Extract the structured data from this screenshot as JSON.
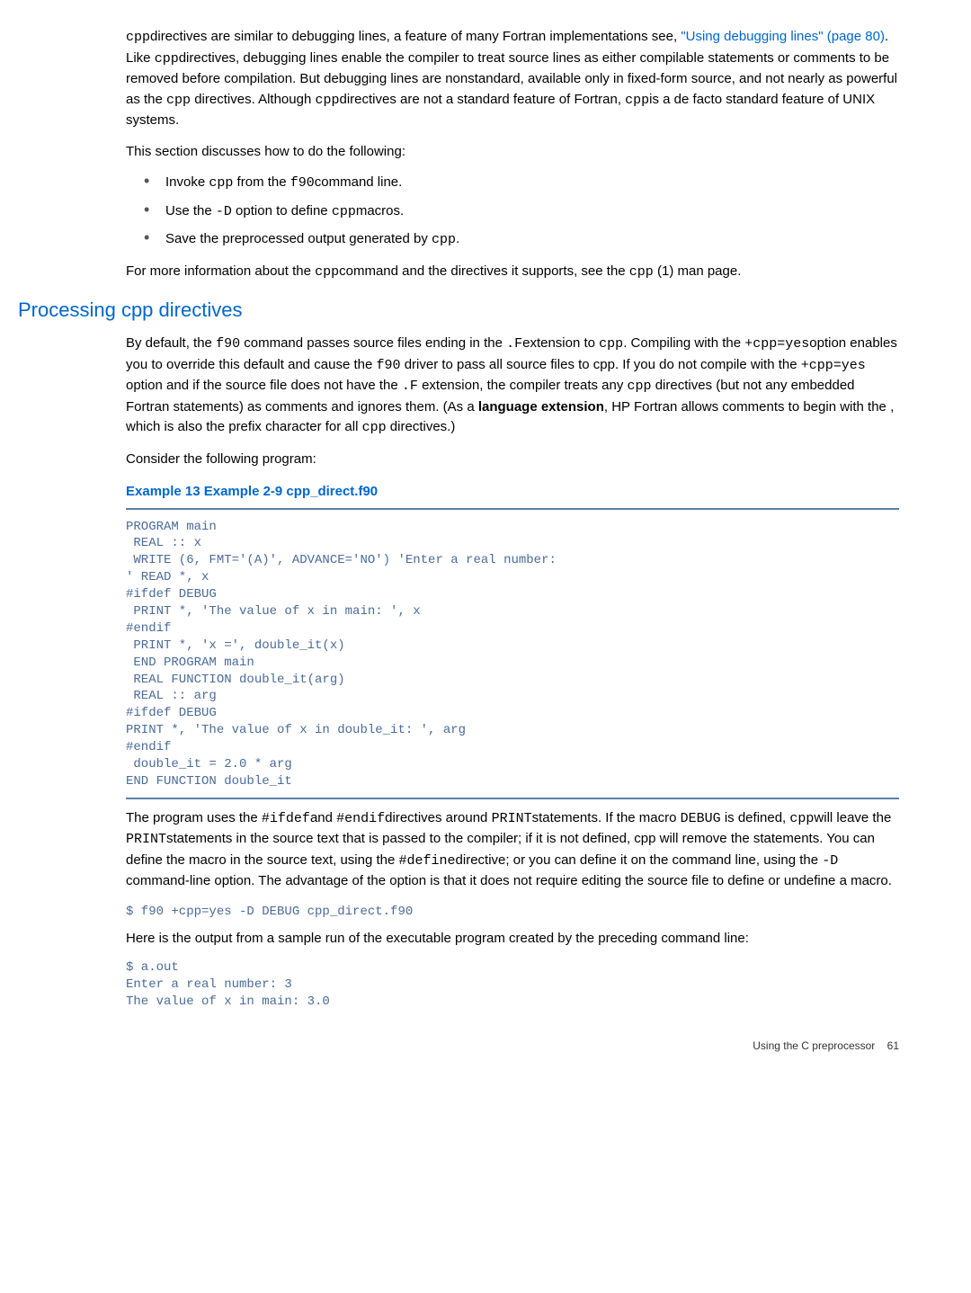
{
  "intro": {
    "p1_a": "directives are similar to debugging lines, a feature of many Fortran implementations see, ",
    "p1_link": "\"Using debugging lines\" (page 80)",
    "p1_b": ". Like ",
    "p1_c": "directives, debugging lines enable the compiler to treat source lines as either compilable statements or comments to be removed before compilation. But debugging lines are nonstandard, available only in fixed-form source, and not nearly as powerful as the ",
    "p1_d": " directives. Although ",
    "p1_e": "directives are not a standard feature of Fortran, ",
    "p1_f": "is a de facto standard feature of UNIX systems.",
    "p2": "This section discusses how to do the following:",
    "b1_a": "Invoke ",
    "b1_b": " from the ",
    "b1_c": "command line.",
    "b2_a": "Use the ",
    "b2_b": " option to define ",
    "b2_c": "macros.",
    "b3_a": "Save the preprocessed output generated by ",
    "b3_b": ".",
    "p3_a": "For more information about the ",
    "p3_b": "command and the directives it supports, see the  ",
    "p3_c": " (1) man page."
  },
  "codes": {
    "cpp": "cpp",
    "f90": "f90",
    "dashD": "-D",
    "dotF": ".F",
    "plusCpp": "+cpp=yes",
    "ifdef": "#ifdef",
    "endif": "#endif",
    "print": "PRINT",
    "debug": "DEBUG",
    "define": "#define"
  },
  "section": {
    "heading": "Processing cpp directives",
    "p1_a": "By default, the ",
    "p1_b": " command passes source files ending in the ",
    "p1_c": "extension to ",
    "p1_d": ". Compiling with the ",
    "p1_e": "option enables you to override this default and cause the ",
    "p1_f": " driver to pass all source files to cpp. If you do not compile with the ",
    "p1_g": " option and if the source file does not have the ",
    "p1_h": " extension, the compiler treats any ",
    "p1_i": " directives (but not any embedded Fortran statements) as comments and ignores them. (As a ",
    "p1_lang": "language extension",
    "p1_j": ", HP Fortran allows comments to begin with the , which is also the prefix character for all ",
    "p1_k": " directives.)",
    "p2": "Consider the following program:",
    "example_title": "Example 13 Example 2-9 cpp_direct.f90",
    "code": "PROGRAM main\n REAL :: x\n WRITE (6, FMT='(A)', ADVANCE='NO') 'Enter a real number:\n' READ *, x\n#ifdef DEBUG\n PRINT *, 'The value of x in main: ', x\n#endif\n PRINT *, 'x =', double_it(x)\n END PROGRAM main\n REAL FUNCTION double_it(arg)\n REAL :: arg\n#ifdef DEBUG\nPRINT *, 'The value of x in double_it: ', arg\n#endif\n double_it = 2.0 * arg\nEND FUNCTION double_it",
    "p3_a": "The program uses the ",
    "p3_b": "and ",
    "p3_c": "directives around ",
    "p3_d": "statements. If the macro ",
    "p3_e": " is defined, ",
    "p3_f": "will leave the ",
    "p3_g": "statements in the source text that is passed to the compiler; if it is not defined, cpp will remove the statements. You can define the macro in the source text, using the ",
    "p3_h": "directive; or you can define it on the command line, using the ",
    "p3_i": " command-line option. The advantage of the option is that it does not require editing the source file to define or undefine a macro.",
    "cmd1": "$ f90 +cpp=yes -D DEBUG cpp_direct.f90",
    "p4": "Here is the output from a sample run of the executable program created by the preceding command line:",
    "out": "$ a.out\nEnter a real number: 3\nThe value of x in main: 3.0"
  },
  "footer": {
    "text": "Using the C preprocessor",
    "page": "61"
  }
}
